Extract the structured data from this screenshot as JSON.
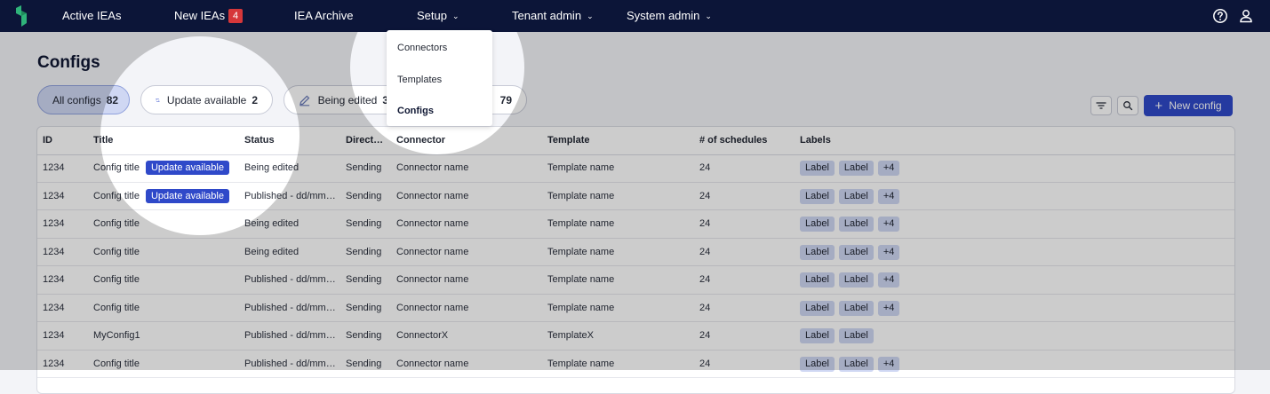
{
  "nav": {
    "items": [
      {
        "label": "Active IEAs"
      },
      {
        "label": "New IEAs",
        "badge": "4"
      },
      {
        "label": "IEA Archive"
      },
      {
        "label": "Setup"
      },
      {
        "label": "Tenant admin"
      },
      {
        "label": "System admin"
      }
    ],
    "icons": [
      "help-icon",
      "user-icon"
    ]
  },
  "setup_menu": {
    "items": [
      "Connectors",
      "Templates",
      "Configs"
    ],
    "selected": "Configs"
  },
  "page": {
    "title": "Configs"
  },
  "filters": [
    {
      "label": "All configs",
      "count": "82",
      "active": true
    },
    {
      "label": "Update available",
      "count": "2",
      "icon": "refresh-icon"
    },
    {
      "label": "Being edited",
      "count": "3",
      "icon": "edit-icon"
    },
    {
      "label": "",
      "count": "79"
    }
  ],
  "toolbar": {
    "new_label": "New config",
    "icons": [
      "filter-icon",
      "search-icon"
    ]
  },
  "table": {
    "columns": [
      "ID",
      "Title",
      "Status",
      "Direct…",
      "Connector",
      "Template",
      "# of schedules",
      "Labels"
    ],
    "update_tag": "Update available",
    "rows": [
      {
        "id": "1234",
        "title": "Config title",
        "update": true,
        "status": "Being edited",
        "direction": "Sending",
        "connector": "Connector name",
        "template": "Template name",
        "schedules": "24",
        "labels": [
          "Label",
          "Label",
          "+4"
        ]
      },
      {
        "id": "1234",
        "title": "Config title",
        "update": true,
        "status": "Published - dd/mm…",
        "direction": "Sending",
        "connector": "Connector name",
        "template": "Template name",
        "schedules": "24",
        "labels": [
          "Label",
          "Label",
          "+4"
        ]
      },
      {
        "id": "1234",
        "title": "Config title",
        "update": false,
        "status": "Being edited",
        "direction": "Sending",
        "connector": "Connector name",
        "template": "Template name",
        "schedules": "24",
        "labels": [
          "Label",
          "Label",
          "+4"
        ]
      },
      {
        "id": "1234",
        "title": "Config title",
        "update": false,
        "status": "Being edited",
        "direction": "Sending",
        "connector": "Connector name",
        "template": "Template name",
        "schedules": "24",
        "labels": [
          "Label",
          "Label",
          "+4"
        ]
      },
      {
        "id": "1234",
        "title": "Config title",
        "update": false,
        "status": "Published - dd/mm…",
        "direction": "Sending",
        "connector": "Connector name",
        "template": "Template name",
        "schedules": "24",
        "labels": [
          "Label",
          "Label",
          "+4"
        ]
      },
      {
        "id": "1234",
        "title": "Config title",
        "update": false,
        "status": "Published - dd/mm…",
        "direction": "Sending",
        "connector": "Connector name",
        "template": "Template name",
        "schedules": "24",
        "labels": [
          "Label",
          "Label",
          "+4"
        ]
      },
      {
        "id": "1234",
        "title": "MyConfig1",
        "update": false,
        "status": "Published - dd/mm…",
        "direction": "Sending",
        "connector": "ConnectorX",
        "template": "TemplateX",
        "schedules": "24",
        "labels": [
          "Label",
          "Label"
        ]
      },
      {
        "id": "1234",
        "title": "Config title",
        "update": false,
        "status": "Published - dd/mm…",
        "direction": "Sending",
        "connector": "Connector name",
        "template": "Template name",
        "schedules": "24",
        "labels": [
          "Label",
          "Label",
          "+4"
        ]
      }
    ]
  },
  "colors": {
    "nav_bg": "#0c1538",
    "primary": "#2f49c9",
    "badge": "#d6373a",
    "label_bg": "#cfd7f3"
  }
}
